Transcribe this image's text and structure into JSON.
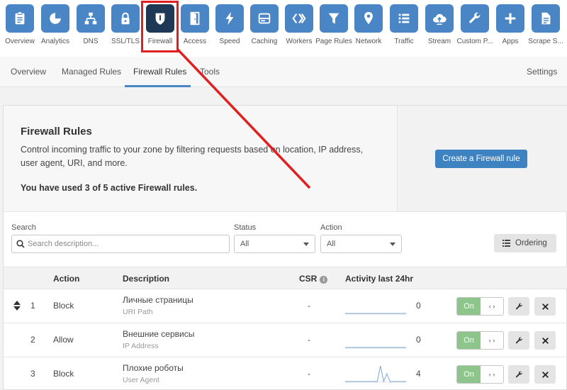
{
  "nav": {
    "apps": [
      {
        "label": "Overview",
        "icon": "clipboard-icon"
      },
      {
        "label": "Analytics",
        "icon": "pie-chart-icon"
      },
      {
        "label": "DNS",
        "icon": "network-tree-icon"
      },
      {
        "label": "SSL/TLS",
        "icon": "lock-icon"
      },
      {
        "label": "Firewall",
        "icon": "shield-icon"
      },
      {
        "label": "Access",
        "icon": "door-icon"
      },
      {
        "label": "Speed",
        "icon": "lightning-icon"
      },
      {
        "label": "Caching",
        "icon": "server-drive-icon"
      },
      {
        "label": "Workers",
        "icon": "workers-chevrons-icon"
      },
      {
        "label": "Page Rules",
        "icon": "filter-funnel-icon"
      },
      {
        "label": "Network",
        "icon": "location-pin-icon"
      },
      {
        "label": "Traffic",
        "icon": "list-icon"
      },
      {
        "label": "Stream",
        "icon": "cloud-upload-icon"
      },
      {
        "label": "Custom P...",
        "icon": "wrench-icon"
      },
      {
        "label": "Apps",
        "icon": "plus-icon"
      },
      {
        "label": "Scrape S...",
        "icon": "document-icon"
      }
    ],
    "active": "Firewall"
  },
  "subnav": {
    "tabs": [
      "Overview",
      "Managed Rules",
      "Firewall Rules",
      "Tools"
    ],
    "active": "Firewall Rules",
    "settings": "Settings"
  },
  "intro": {
    "title": "Firewall Rules",
    "description": "Control incoming traffic to your zone by filtering requests based on location, IP address, user agent, URI, and more.",
    "usage": "You have used 3 of 5 active Firewall rules.",
    "create_button": "Create a Firewall rule"
  },
  "filters": {
    "search_label": "Search",
    "search_placeholder": "Search description...",
    "status_label": "Status",
    "status_value": "All",
    "action_label": "Action",
    "action_value": "All",
    "ordering_button": "Ordering"
  },
  "table": {
    "headers": {
      "action": "Action",
      "description": "Description",
      "csr": "CSR",
      "activity": "Activity last 24hr"
    },
    "rows": [
      {
        "index": "1",
        "action": "Block",
        "description": "Личные страницы",
        "field": "URI Path",
        "csr": "-",
        "count": "0",
        "toggle": "On",
        "spark": [
          0,
          0,
          0,
          0,
          0,
          0,
          0,
          0,
          0,
          0,
          0,
          0,
          0,
          0,
          0,
          0,
          0,
          0,
          0,
          0
        ]
      },
      {
        "index": "2",
        "action": "Allow",
        "description": "Внешние сервисы",
        "field": "IP Address",
        "csr": "-",
        "count": "0",
        "toggle": "On",
        "spark": [
          0,
          0,
          0,
          0,
          0,
          0,
          0,
          0,
          0,
          0,
          0,
          0,
          0,
          0,
          0,
          0,
          0,
          0,
          0,
          0
        ]
      },
      {
        "index": "3",
        "action": "Block",
        "description": "Плохие роботы",
        "field": "User Agent",
        "csr": "-",
        "count": "4",
        "toggle": "On",
        "spark": [
          0,
          0,
          0,
          0,
          0,
          0,
          0,
          0,
          0,
          0,
          0,
          2,
          0,
          1,
          0,
          0,
          0,
          0,
          0,
          0
        ]
      }
    ]
  },
  "colors": {
    "tile": "#4a86c5",
    "tile_active": "#1f3855",
    "primary": "#3f82c2",
    "toggle_on": "#8dc58d",
    "annotation": "#e02020"
  }
}
